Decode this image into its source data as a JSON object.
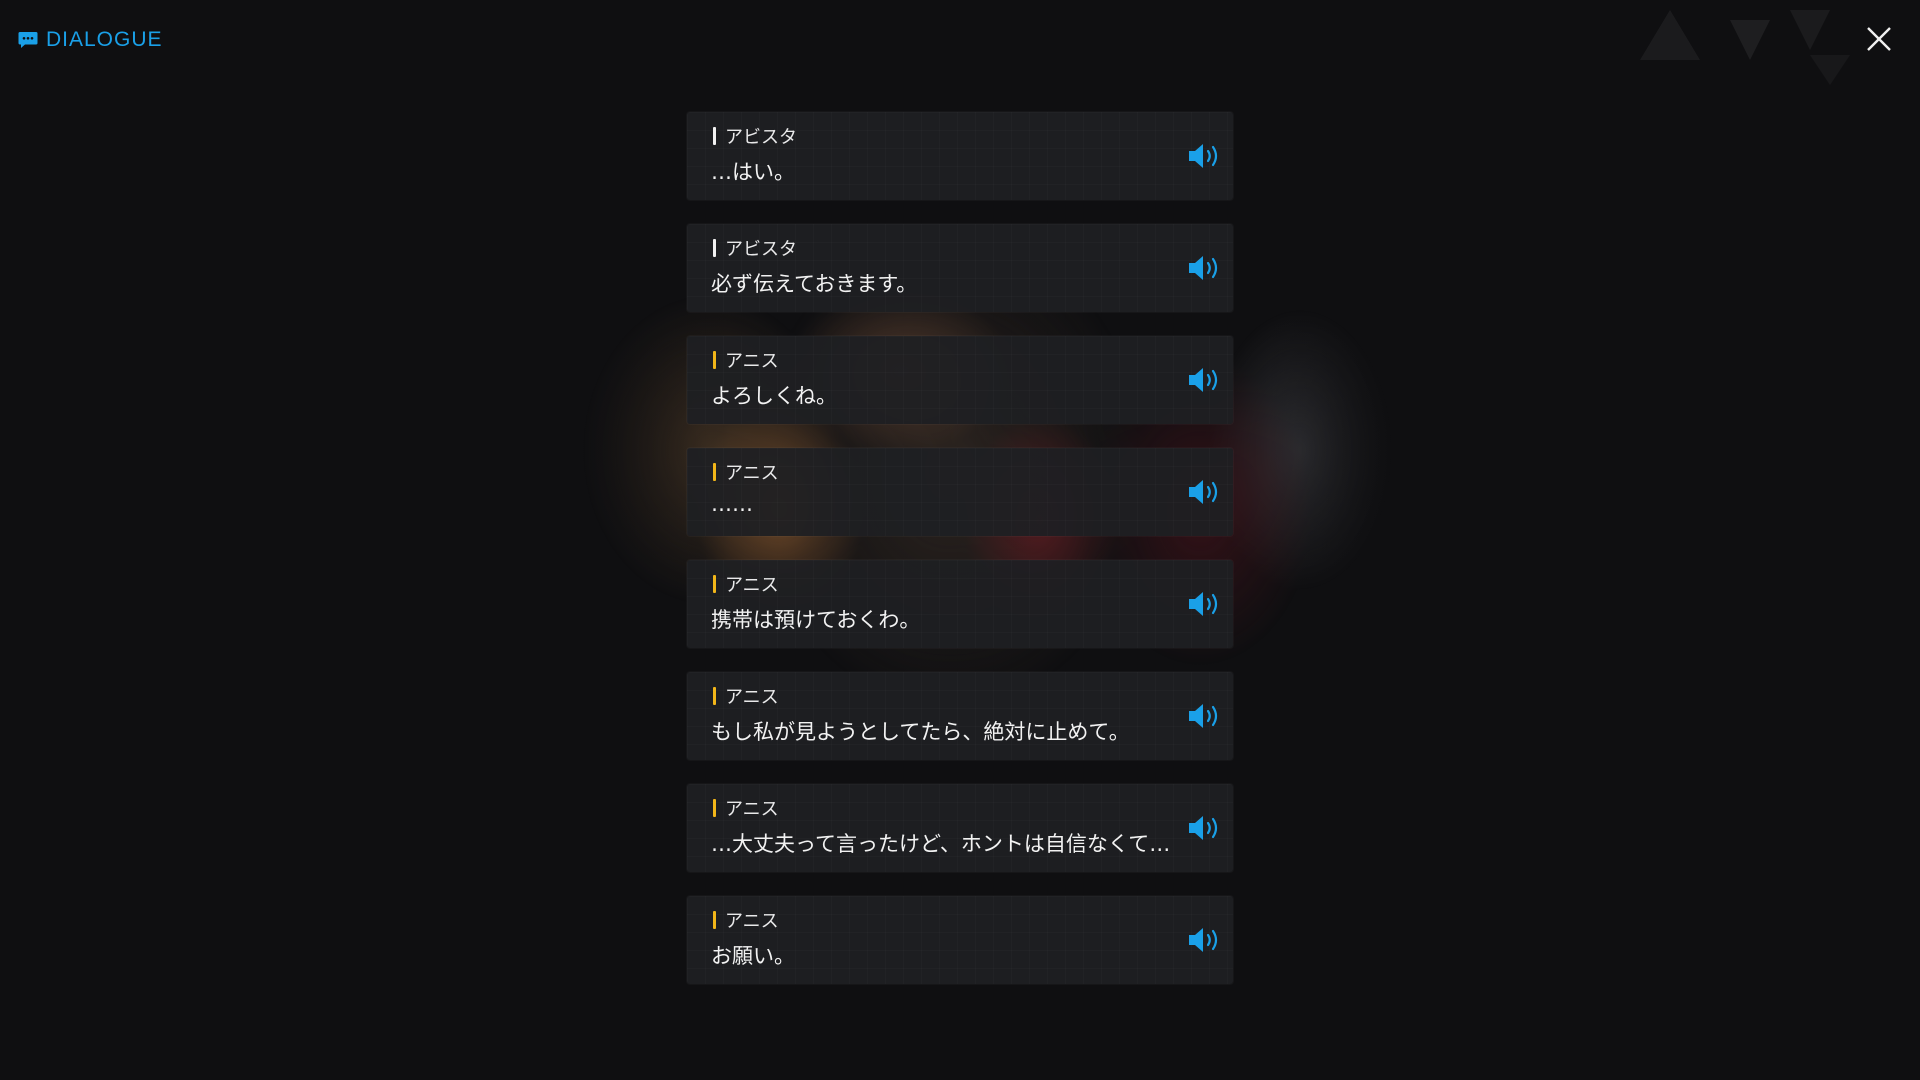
{
  "header": {
    "title": "DIALOGUE",
    "icon": "chat-bubble-icon",
    "accent_color": "#1aa0e8"
  },
  "close": {
    "icon": "close-icon"
  },
  "dialogue": [
    {
      "speaker": "アビスタ",
      "text": "…はい。",
      "name_color": "#f2f2f2",
      "voice_icon": "speaker-icon"
    },
    {
      "speaker": "アビスタ",
      "text": "必ず伝えておきます。",
      "name_color": "#f2f2f2",
      "voice_icon": "speaker-icon"
    },
    {
      "speaker": "アニス",
      "text": "よろしくね。",
      "name_color": "#f2b619",
      "voice_icon": "speaker-icon"
    },
    {
      "speaker": "アニス",
      "text": "……",
      "name_color": "#f2b619",
      "voice_icon": "speaker-icon"
    },
    {
      "speaker": "アニス",
      "text": "携帯は預けておくわ。",
      "name_color": "#f2b619",
      "voice_icon": "speaker-icon"
    },
    {
      "speaker": "アニス",
      "text": "もし私が見ようとしてたら、絶対に止めて。",
      "name_color": "#f2b619",
      "voice_icon": "speaker-icon"
    },
    {
      "speaker": "アニス",
      "text": "…大丈夫って言ったけど、ホントは自信なくて…",
      "name_color": "#f2b619",
      "voice_icon": "speaker-icon"
    },
    {
      "speaker": "アニス",
      "text": "お願い。",
      "name_color": "#f2b619",
      "voice_icon": "speaker-icon"
    }
  ]
}
